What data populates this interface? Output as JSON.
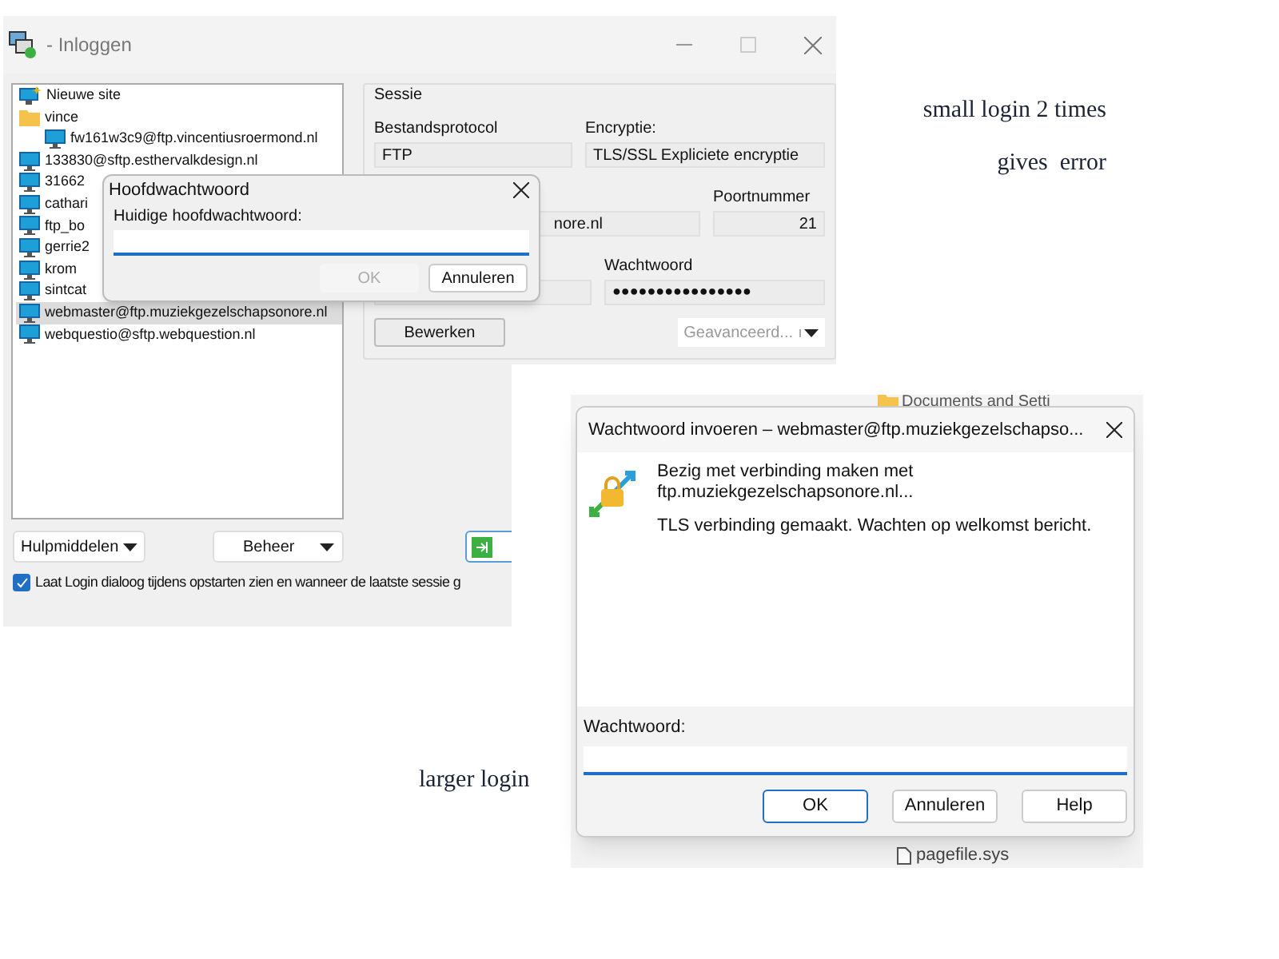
{
  "annotations": [
    {
      "text": "small login 2 times"
    },
    {
      "text": "gives  error"
    },
    {
      "text": "larger login"
    }
  ],
  "login_window": {
    "title": "- Inloggen",
    "sites": [
      {
        "label": "Nieuwe site",
        "kind": "new",
        "selected": false
      },
      {
        "label": "vince",
        "kind": "folder",
        "selected": false,
        "children": [
          {
            "label": "fw161w3c9@ftp.vincentiusroermond.nl",
            "kind": "site",
            "selected": false
          }
        ]
      },
      {
        "label": "133830@sftp.esthervalkdesign.nl",
        "kind": "site",
        "selected": false
      },
      {
        "label": "31662",
        "kind": "site",
        "selected": false
      },
      {
        "label": "cathari",
        "kind": "site",
        "selected": false
      },
      {
        "label": "ftp_bo",
        "kind": "site",
        "selected": false
      },
      {
        "label": "gerrie2",
        "kind": "site",
        "selected": false
      },
      {
        "label": "krom",
        "kind": "site",
        "selected": false
      },
      {
        "label": "sintcat",
        "kind": "site",
        "selected": false
      },
      {
        "label": "webmaster@ftp.muziekgezelschapsonore.nl",
        "kind": "site",
        "selected": true
      },
      {
        "label": "webquestio@sftp.webquestion.nl",
        "kind": "site",
        "selected": false
      }
    ],
    "session": {
      "heading": "Sessie",
      "protocol_label": "Bestandsprotocol",
      "protocol": "FTP",
      "encryption_label": "Encryptie:",
      "encryption": "TLS/SSL Expliciete encryptie",
      "host": "nore.nl",
      "port_label": "Poortnummer",
      "port": "21",
      "password_label": "Wachtwoord",
      "password": "●●●●●●●●●●●●●●●●",
      "edit_button": "Bewerken",
      "advanced_button": {
        "label": "Geavanceerd...",
        "disabled": true
      }
    },
    "tools_button": "Hulpmiddelen",
    "manage_button": "Beheer",
    "show_login_checkbox": {
      "label": "Laat Login dialoog tijdens opstarten zien en wanneer de laatste sessie g",
      "checked": true
    }
  },
  "master_password_dialog": {
    "title": "Hoofdwachtwoord",
    "label": "Huidige hoofdwachtwoord:",
    "ok": {
      "label": "OK",
      "disabled": true
    },
    "cancel": "Annuleren"
  },
  "password_dialog": {
    "title": "Wachtwoord invoeren – webmaster@ftp.muziekgezelschapso...",
    "message": "Bezig met verbinding maken met ftp.muziekgezelschapsonore.nl...",
    "status": "TLS verbinding gemaakt. Wachten op welkomst bericht.",
    "label": "Wachtwoord:",
    "ok": {
      "label": "OK",
      "disabled": false
    },
    "cancel": "Annuleren",
    "help": "Help"
  },
  "background_files": [
    {
      "name": "Documents and Setti"
    },
    {
      "name": "pagefile.sys"
    }
  ]
}
